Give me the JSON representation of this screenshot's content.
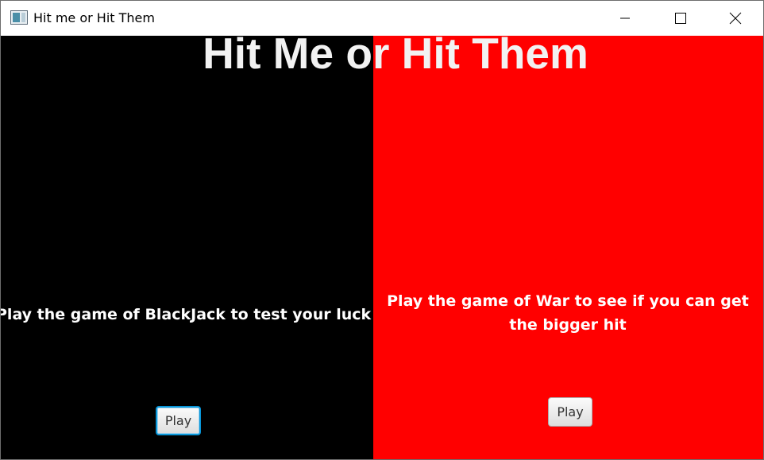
{
  "window": {
    "title": "Hit me or Hit Them"
  },
  "main": {
    "heading": "Hit Me or Hit Them"
  },
  "left_panel": {
    "color": "#000000",
    "description": "Play the game of BlackJack to test your luck",
    "play_label": "Play"
  },
  "right_panel": {
    "color": "#ff0000",
    "description": "Play the game of War to see if you can get the bigger hit",
    "play_label": "Play"
  },
  "icons": {
    "app": "app-window-icon",
    "minimize": "minimize-icon",
    "maximize": "maximize-icon",
    "close": "close-icon"
  }
}
